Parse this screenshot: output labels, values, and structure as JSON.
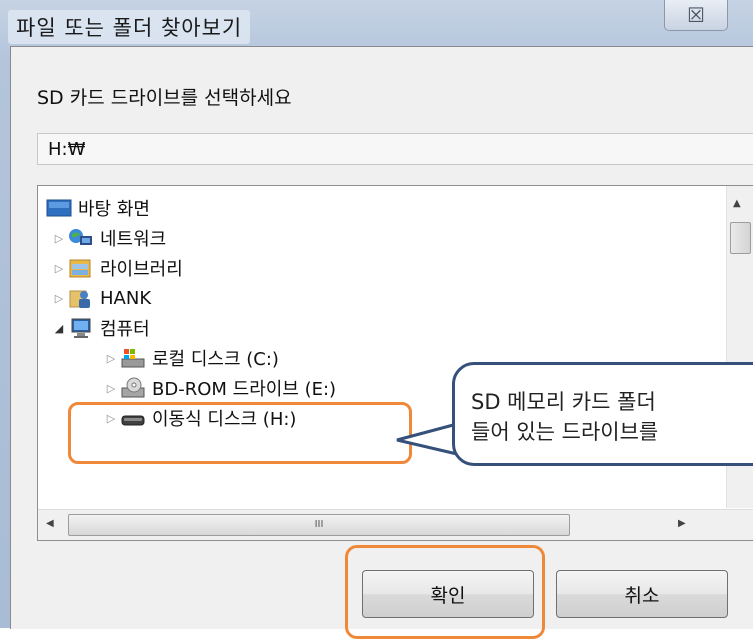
{
  "window": {
    "title": "파일 또는 폴더 찾아보기",
    "close_glyph": "☒"
  },
  "prompt_text": "SD 카드 드라이브를 선택하세요",
  "path_value": "H:₩",
  "tree": {
    "items": [
      {
        "label": "바탕 화면",
        "icon": "desktop-icon",
        "expander": ""
      },
      {
        "label": "네트워크",
        "icon": "network-icon",
        "expander": "▷"
      },
      {
        "label": "라이브러리",
        "icon": "library-icon",
        "expander": "▷"
      },
      {
        "label": "HANK",
        "icon": "user-folder-icon",
        "expander": "▷"
      },
      {
        "label": "컴퓨터",
        "icon": "computer-icon",
        "expander": "◢"
      },
      {
        "label": "로컬 디스크 (C:)",
        "icon": "local-disk-icon",
        "expander": "▷"
      },
      {
        "label": "BD-ROM 드라이브 (E:)",
        "icon": "optical-drive-icon",
        "expander": "▷"
      },
      {
        "label": "이동식 디스크 (H:)",
        "icon": "removable-disk-icon",
        "expander": "▷"
      }
    ]
  },
  "scroll": {
    "up": "▲",
    "left": "◀",
    "right": "▶",
    "grip": "III"
  },
  "buttons": {
    "ok": "확인",
    "cancel": "취소"
  },
  "callout": {
    "line1": "SD 메모리 카드 폴더",
    "line2": "들어 있는 드라이브를"
  },
  "colors": {
    "highlight": "#f0883a",
    "callout_border": "#35507a"
  }
}
